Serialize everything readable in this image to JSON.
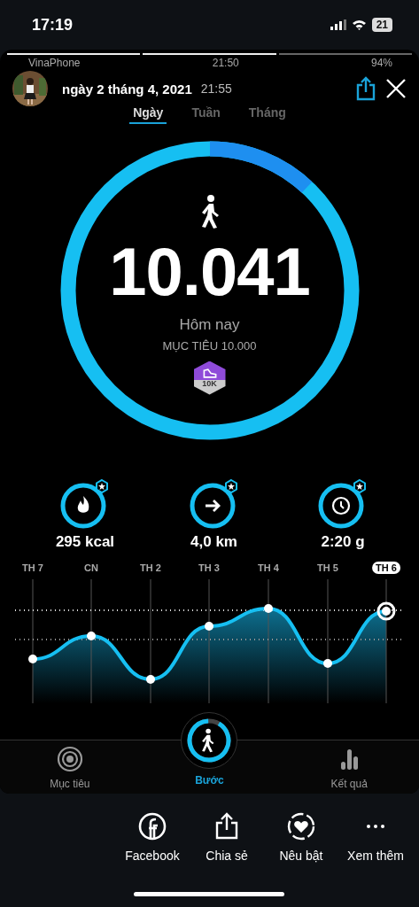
{
  "status_bar": {
    "time": "17:19",
    "battery": "21"
  },
  "story": {
    "segments": [
      {
        "level": 1
      },
      {
        "level": 1
      },
      {
        "level": 0
      }
    ],
    "inner_status": {
      "carrier": "VinaPhone",
      "time": "21:50",
      "battery": "94%"
    },
    "header": {
      "date": "ngày 2 tháng 4, 2021",
      "time": "21:55"
    }
  },
  "app": {
    "tabs": [
      {
        "label": "Ngày",
        "selected": true
      },
      {
        "label": "Tuần",
        "selected": false
      },
      {
        "label": "Tháng",
        "selected": false
      }
    ],
    "steps": "10.041",
    "period": "Hôm nay",
    "goal": "MỤC TIÊU 10.000",
    "badge": "10K",
    "stats": [
      {
        "kind": "calories",
        "value": "295 kcal"
      },
      {
        "kind": "distance",
        "value": "4,0 km"
      },
      {
        "kind": "time",
        "value": "2:20 g"
      }
    ],
    "days": [
      {
        "label": "TH 7",
        "selected": false
      },
      {
        "label": "CN",
        "selected": false
      },
      {
        "label": "TH 2",
        "selected": false
      },
      {
        "label": "TH 3",
        "selected": false
      },
      {
        "label": "TH 4",
        "selected": false
      },
      {
        "label": "TH 5",
        "selected": false
      },
      {
        "label": "TH 6",
        "selected": true
      }
    ],
    "nav": [
      {
        "kind": "goal",
        "label": "Mục tiêu",
        "selected": false
      },
      {
        "kind": "steps",
        "label": "Bước",
        "selected": true
      },
      {
        "kind": "results",
        "label": "Kết quả",
        "selected": false
      }
    ]
  },
  "actions": [
    {
      "kind": "facebook",
      "label": "Facebook"
    },
    {
      "kind": "share",
      "label": "Chia sẻ"
    },
    {
      "kind": "highlight",
      "label": "Nêu bật"
    },
    {
      "kind": "more",
      "label": "Xem thêm"
    }
  ]
}
